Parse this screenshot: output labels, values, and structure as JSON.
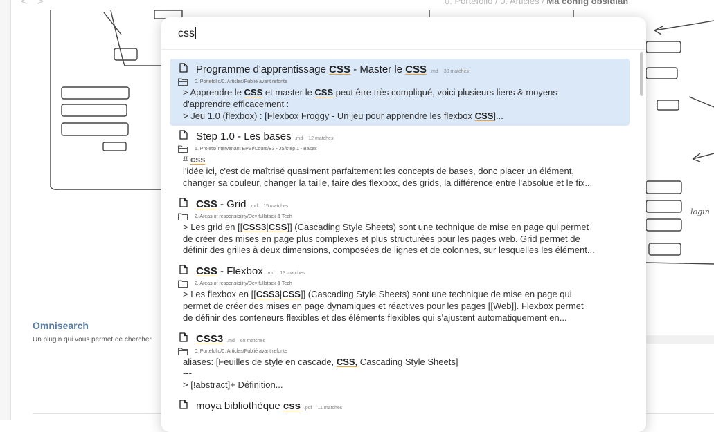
{
  "header": {
    "nav_back": "<",
    "nav_forward": ">",
    "breadcrumb": [
      "0. Portefolio",
      "0. Articles",
      "Ma config obsidian"
    ]
  },
  "background": {
    "plugin_title": "Omnisearch",
    "plugin_desc": "Un plugin qui vous permet de chercher",
    "sketch_label": "login"
  },
  "search": {
    "query": "css"
  },
  "results": [
    {
      "title_parts": [
        "Programme d'apprentissage ",
        "CSS",
        " - Master le ",
        "CSS"
      ],
      "ext": ".md",
      "matches": "30 matches",
      "path": "0. Portefolio/0. Articles/Publié avant refonte",
      "lines": [
        [
          "> Apprendre le ",
          "CSS",
          " et master le ",
          "CSS",
          " peut être très compliqué, voici plusieurs liens & moyens"
        ],
        [
          "d'apprendre efficacement :"
        ],
        [
          "> Jeu 1.0 (flexbox) : [Flexbox Froggy - Un jeu pour apprendre les flexbox ",
          "CSS",
          "]..."
        ]
      ]
    },
    {
      "title_parts": [
        "Step 1.0 - Les bases"
      ],
      "ext": ".md",
      "matches": "12 matches",
      "path": "1. Projets/Intervenant EPSI/Cours/B3 - JS/step 1 - Bases",
      "lines": [
        [
          "# ",
          "css"
        ],
        [
          "l'idée ici, c'est de maîtrisé quasiment parfaitement les concepts de bases, donc placer un élément,"
        ],
        [
          "changer sa couleur, changer la taille, faire des flexbox, des grids, la différence entre l'absolue et le fix..."
        ]
      ]
    },
    {
      "title_parts": [
        "",
        "CSS",
        " - Grid"
      ],
      "ext": ".md",
      "matches": "15 matches",
      "path": "2. Areas of responsibility/Dev fullstack & Tech",
      "lines": [
        [
          "> Les grid en [[",
          "CSS3",
          "|",
          "CSS",
          "]] (Cascading Style Sheets) sont une technique de mise en page qui permet"
        ],
        [
          "de créer des mises en page plus complexes et plus structurées pour les pages web. Grid permet de"
        ],
        [
          "définir des grilles à deux dimensions, composées de lignes et de colonnes, sur lesquelles les élément..."
        ]
      ]
    },
    {
      "title_parts": [
        "",
        "CSS",
        " - Flexbox"
      ],
      "ext": ".md",
      "matches": "13 matches",
      "path": "2. Areas of responsibility/Dev fullstack & Tech",
      "lines": [
        [
          "> Les flexbox en [[",
          "CSS3",
          "|",
          "CSS",
          "]] (Cascading Style Sheets) sont une technique de mise en page qui"
        ],
        [
          "permet de créer des mises en page dynamiques et réactives pour les pages [[Web]]. Flexbox permet"
        ],
        [
          "de définir des conteneurs flexibles et des éléments flexibles qui s'ajustent automatiquement en..."
        ]
      ]
    },
    {
      "title_parts": [
        "",
        "CSS3"
      ],
      "ext": ".md",
      "matches": "68 matches",
      "path": "0. Portefolio/0. Articles/Publié avant refonte",
      "lines": [
        [
          "aliases: [Feuilles de style en cascade, ",
          "CSS,",
          " Cascading Style Sheets]"
        ],
        [
          "---"
        ],
        [
          "> [!abstract]+ Définition..."
        ]
      ]
    },
    {
      "title_parts": [
        "moya bibliothèque ",
        "css"
      ],
      "ext": ".pdf",
      "matches": "11 matches",
      "path": "",
      "lines": []
    }
  ]
}
